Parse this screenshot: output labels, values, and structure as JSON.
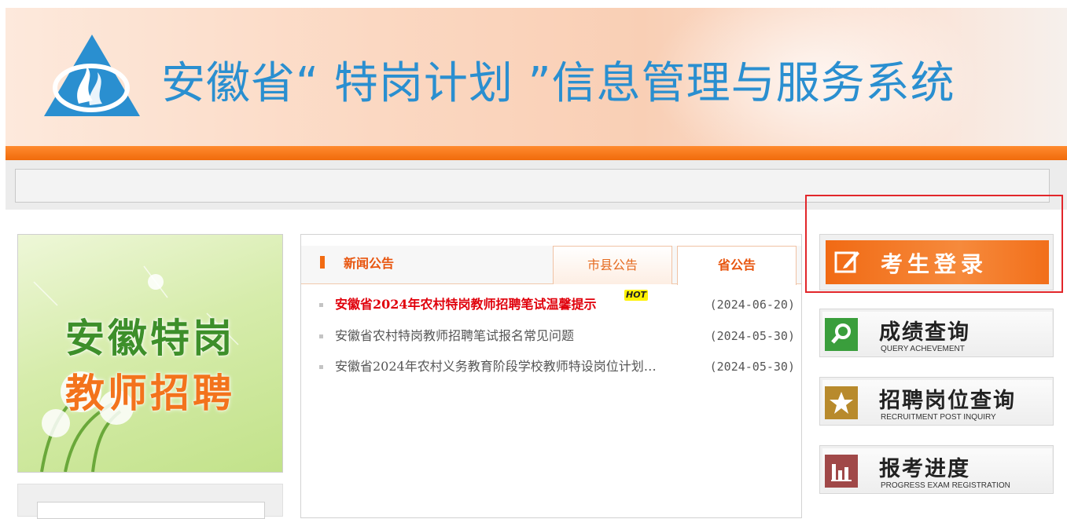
{
  "header": {
    "title": "安徽省“ 特岗计划 ”信息管理与服务系统"
  },
  "promo": {
    "line1": "安徽特岗",
    "line2": "教师招聘"
  },
  "news": {
    "section_title": "新闻公告",
    "tabs": [
      {
        "label": "市县公告",
        "active": false
      },
      {
        "label": "省公告",
        "active": true
      }
    ],
    "items": [
      {
        "text": "安徽省2024年农村特岗教师招聘笔试温馨提示",
        "date": "(2024-06-20)",
        "hot": true,
        "badge": "HOT"
      },
      {
        "text": "安徽省农村特岗教师招聘笔试报名常见问题",
        "date": "(2024-05-30)",
        "hot": false
      },
      {
        "text": "安徽省2024年农村义务教育阶段学校教师特设岗位计划…",
        "date": "(2024-05-30)",
        "hot": false
      }
    ]
  },
  "actions": {
    "login": {
      "label": "考生登录",
      "icon": "edit-icon"
    },
    "buttons": [
      {
        "cn": "成绩查询",
        "en": "QUERY ACHEVEMENT",
        "icon": "search-icon",
        "color": "#3a9e3c"
      },
      {
        "cn": "招聘岗位查询",
        "en": "RECRUITMENT POST INQUIRY",
        "icon": "star-icon",
        "color": "#b88a2c"
      },
      {
        "cn": "报考进度",
        "en": "PROGRESS EXAM REGISTRATION",
        "icon": "bar-chart-icon",
        "color": "#a04848"
      }
    ]
  },
  "colors": {
    "accent_orange": "#f26b12",
    "title_blue": "#2a8fd0",
    "hot_red": "#e0000b"
  }
}
